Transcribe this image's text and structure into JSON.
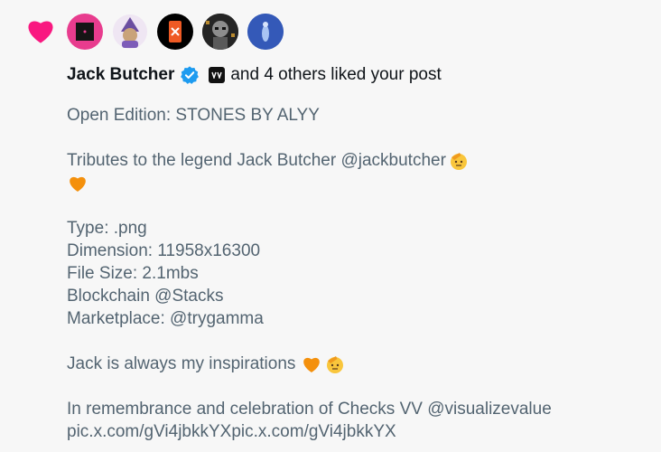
{
  "notification": {
    "type_icon": "heart-icon",
    "accent_color": "#f91880",
    "avatars": [
      {
        "name": "avatar-pink-square",
        "icon": "black-square-icon"
      },
      {
        "name": "avatar-purple-character",
        "icon": "character-icon"
      },
      {
        "name": "avatar-orange-badge",
        "icon": "orange-card-icon"
      },
      {
        "name": "avatar-dark-art",
        "icon": "portrait-icon"
      },
      {
        "name": "avatar-blue",
        "icon": "blue-figure-icon"
      }
    ],
    "headline": {
      "user_name": "Jack Butcher",
      "verified_icon": "verified-icon",
      "suffix": "and 4 others liked your post"
    }
  },
  "post": {
    "lines": [
      "Open Edition: STONES BY ALYY",
      "",
      "Tributes to the legend Jack Butcher @jackbutcher",
      "",
      "",
      "Type: .png",
      "Dimension: 11958x16300",
      "File Size: 2.1mbs",
      "Blockchain @Stacks",
      "Marketplace: @trygamma",
      "",
      "Jack is always my inspirations",
      "",
      "In remembrance and celebration of Checks VV @visualizevalue",
      "pic.x.com/gVi4jbkkYXpic.x.com/gVi4jbkkYX"
    ]
  }
}
